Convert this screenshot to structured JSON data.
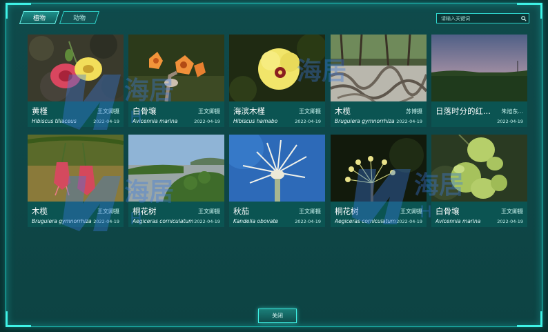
{
  "tabs": [
    {
      "label": "植物",
      "active": true
    },
    {
      "label": "动物",
      "active": false
    }
  ],
  "search": {
    "placeholder": "请输入关键词"
  },
  "cards": [
    {
      "title": "黄槿",
      "latin": "Hibiscus tiliaceus",
      "author": "王文卿摄",
      "date": "2022-04-19"
    },
    {
      "title": "白骨壤",
      "latin": "Avicennia marina",
      "author": "王文卿摄",
      "date": "2022-04-19"
    },
    {
      "title": "海滨木槿",
      "latin": "Hibiscus hamabo",
      "author": "王文卿摄",
      "date": "2022-04-19"
    },
    {
      "title": "木榄",
      "latin": "Bruguiera gymnorrhiza",
      "author": "苏博摄",
      "date": "2022-04-19"
    },
    {
      "title": "日落时分的红...",
      "latin": "",
      "author": "朱旭东...",
      "date": "2022-04-19"
    },
    {
      "title": "木榄",
      "latin": "Bruguiera gymnorrhiza",
      "author": "王文卿摄",
      "date": "2022-04-19"
    },
    {
      "title": "桐花树",
      "latin": "Aegiceras corniculatum",
      "author": "王文卿摄",
      "date": "2022-04-19"
    },
    {
      "title": "秋茄",
      "latin": "Kandelia obovate",
      "author": "王文卿摄",
      "date": "2022-04-19"
    },
    {
      "title": "桐花树",
      "latin": "Aegiceras corniculatum",
      "author": "王文卿摄",
      "date": "2022-04-19"
    },
    {
      "title": "白骨壤",
      "latin": "Avicennia marina",
      "author": "王文卿摄",
      "date": "2022-04-19"
    }
  ],
  "watermark": {
    "text": "海居",
    "sub": "H"
  },
  "close_label": "关闭",
  "colors": {
    "accent": "#3ff2e6",
    "panel": "#0f4a4b",
    "card": "#0b5452"
  }
}
